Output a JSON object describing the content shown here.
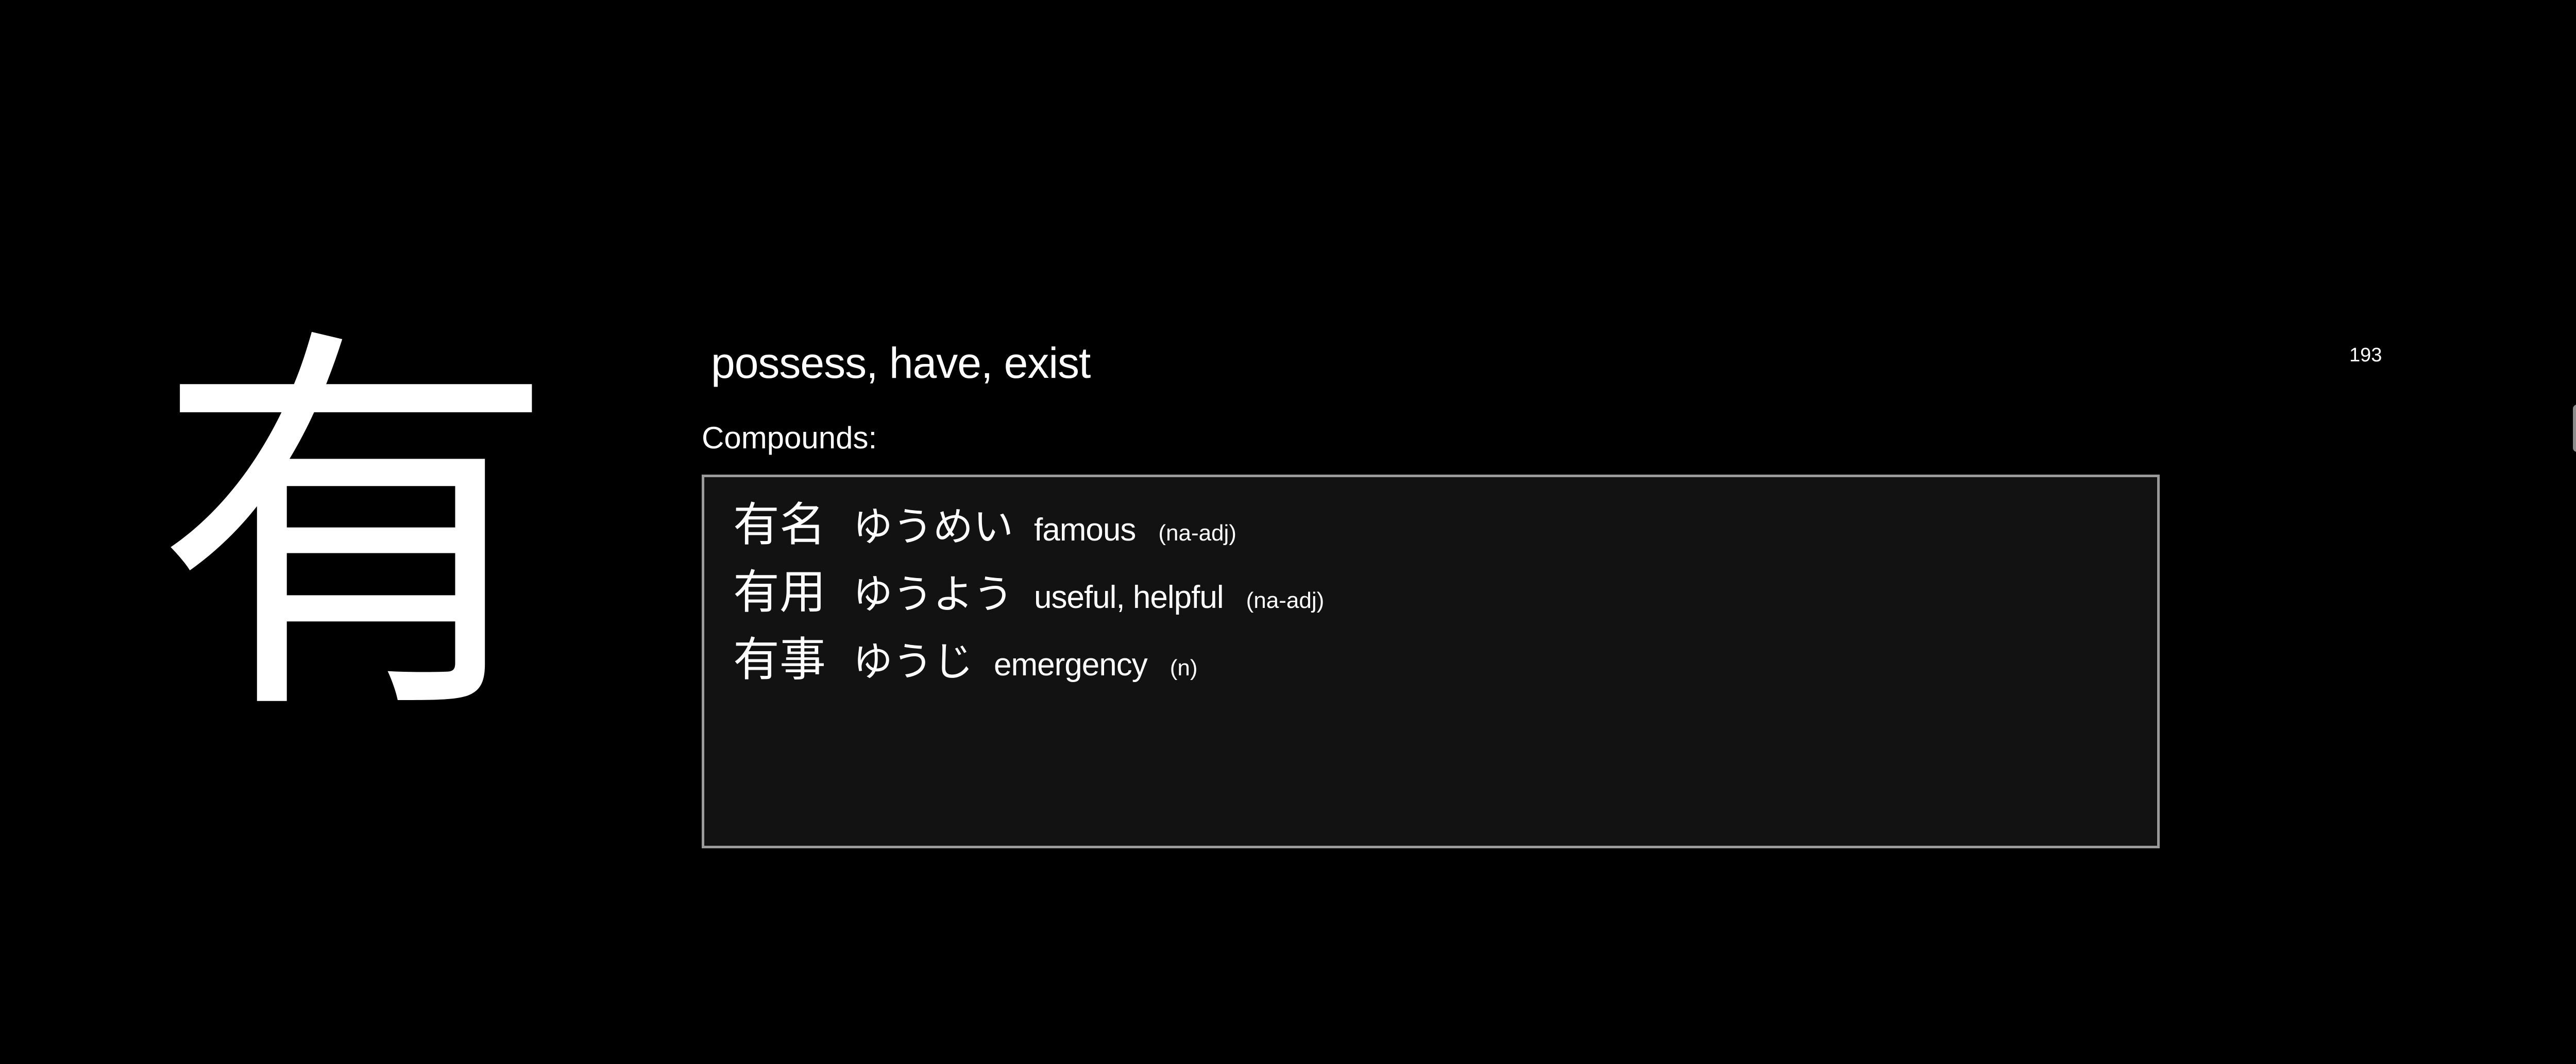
{
  "card": {
    "kanji": "有",
    "meaning": "possess, have, exist",
    "number": "193",
    "compounds_label": "Compounds:",
    "compounds": [
      {
        "word": "有名",
        "reading": "ゆうめい",
        "meaning": "famous",
        "pos": "(na-adj)"
      },
      {
        "word": "有用",
        "reading": "ゆうよう",
        "meaning": "useful, helpful",
        "pos": "(na-adj)"
      },
      {
        "word": "有事",
        "reading": "ゆうじ",
        "meaning": "emergency",
        "pos": "(n)"
      }
    ]
  },
  "colors": {
    "background": "#000000",
    "text": "#ffffff",
    "box_background": "#121212",
    "box_border": "#9a9a9a"
  }
}
